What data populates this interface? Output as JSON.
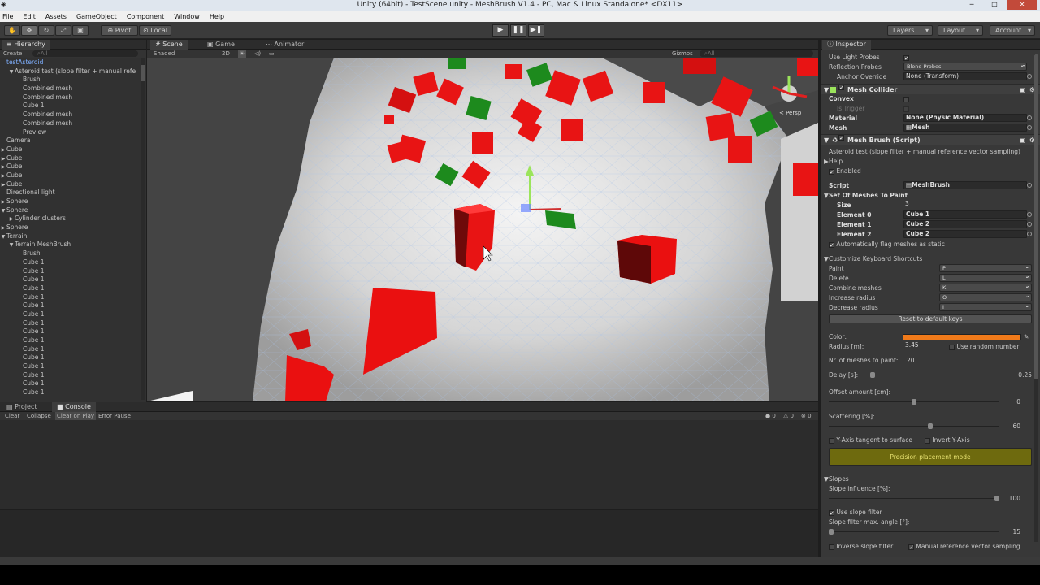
{
  "window": {
    "title": "Unity (64bit) - TestScene.unity - MeshBrush V1.4 - PC, Mac & Linux Standalone* <DX11>",
    "controls": [
      "─",
      "□",
      "✕"
    ]
  },
  "menu": [
    "File",
    "Edit",
    "Assets",
    "GameObject",
    "Component",
    "Window",
    "Help"
  ],
  "toolbar": {
    "pivot": "Pivot",
    "local": "Local",
    "play_glyphs": [
      "▶",
      "❚❚",
      "▶❚"
    ],
    "layers": "Layers",
    "layout": "Layout",
    "account": "Account"
  },
  "hierarchy": {
    "tab": "Hierarchy",
    "create": "Create",
    "search_placeholder": "All",
    "items": [
      {
        "label": "testAsteroid",
        "indent": 0,
        "arrow": "",
        "selected": true
      },
      {
        "label": "Asteroid test (slope filter + manual refe",
        "indent": 1,
        "arrow": "▼",
        "selected": false
      },
      {
        "label": "Brush",
        "indent": 2,
        "arrow": "",
        "selected": false
      },
      {
        "label": "Combined mesh",
        "indent": 2,
        "arrow": "",
        "selected": false
      },
      {
        "label": "Combined mesh",
        "indent": 2,
        "arrow": "",
        "selected": false
      },
      {
        "label": "Cube 1",
        "indent": 2,
        "arrow": "",
        "selected": false
      },
      {
        "label": "Combined mesh",
        "indent": 2,
        "arrow": "",
        "selected": false
      },
      {
        "label": "Combined mesh",
        "indent": 2,
        "arrow": "",
        "selected": false
      },
      {
        "label": "Preview",
        "indent": 2,
        "arrow": "",
        "selected": false
      },
      {
        "label": "Camera",
        "indent": 0,
        "arrow": "",
        "selected": false
      },
      {
        "label": "Cube",
        "indent": 0,
        "arrow": "▶",
        "selected": false
      },
      {
        "label": "Cube",
        "indent": 0,
        "arrow": "▶",
        "selected": false
      },
      {
        "label": "Cube",
        "indent": 0,
        "arrow": "▶",
        "selected": false
      },
      {
        "label": "Cube",
        "indent": 0,
        "arrow": "▶",
        "selected": false
      },
      {
        "label": "Cube",
        "indent": 0,
        "arrow": "▶",
        "selected": false
      },
      {
        "label": "Directional light",
        "indent": 0,
        "arrow": "",
        "selected": false
      },
      {
        "label": "Sphere",
        "indent": 0,
        "arrow": "▶",
        "selected": false
      },
      {
        "label": "Sphere",
        "indent": 0,
        "arrow": "▼",
        "selected": false
      },
      {
        "label": "Cylinder clusters",
        "indent": 1,
        "arrow": "▶",
        "selected": false
      },
      {
        "label": "Sphere",
        "indent": 0,
        "arrow": "▶",
        "selected": false
      },
      {
        "label": "Terrain",
        "indent": 0,
        "arrow": "▼",
        "selected": false
      },
      {
        "label": "Terrain MeshBrush",
        "indent": 1,
        "arrow": "▼",
        "selected": false
      },
      {
        "label": "Brush",
        "indent": 2,
        "arrow": "",
        "selected": false
      },
      {
        "label": "Cube 1",
        "indent": 2,
        "arrow": "",
        "selected": false
      },
      {
        "label": "Cube 1",
        "indent": 2,
        "arrow": "",
        "selected": false
      },
      {
        "label": "Cube 1",
        "indent": 2,
        "arrow": "",
        "selected": false
      },
      {
        "label": "Cube 1",
        "indent": 2,
        "arrow": "",
        "selected": false
      },
      {
        "label": "Cube 1",
        "indent": 2,
        "arrow": "",
        "selected": false
      },
      {
        "label": "Cube 1",
        "indent": 2,
        "arrow": "",
        "selected": false
      },
      {
        "label": "Cube 1",
        "indent": 2,
        "arrow": "",
        "selected": false
      },
      {
        "label": "Cube 1",
        "indent": 2,
        "arrow": "",
        "selected": false
      },
      {
        "label": "Cube 1",
        "indent": 2,
        "arrow": "",
        "selected": false
      },
      {
        "label": "Cube 1",
        "indent": 2,
        "arrow": "",
        "selected": false
      },
      {
        "label": "Cube 1",
        "indent": 2,
        "arrow": "",
        "selected": false
      },
      {
        "label": "Cube 1",
        "indent": 2,
        "arrow": "",
        "selected": false
      },
      {
        "label": "Cube 1",
        "indent": 2,
        "arrow": "",
        "selected": false
      },
      {
        "label": "Cube 1",
        "indent": 2,
        "arrow": "",
        "selected": false
      },
      {
        "label": "Cube 1",
        "indent": 2,
        "arrow": "",
        "selected": false
      },
      {
        "label": "Cube 1",
        "indent": 2,
        "arrow": "",
        "selected": false
      }
    ]
  },
  "scene": {
    "tabs": [
      "Scene",
      "Game",
      "Animator"
    ],
    "shaded": "Shaded",
    "mode_2d": "2D",
    "gizmos": "Gizmos",
    "search_placeholder": "All",
    "persp": "< Persp"
  },
  "console": {
    "tabs": [
      "Project",
      "Console"
    ],
    "buttons": [
      "Clear",
      "Collapse",
      "Clear on Play",
      "Error Pause"
    ],
    "counts": [
      "0",
      "0",
      "0"
    ]
  },
  "inspector": {
    "tab": "Inspector",
    "use_light_probes": "Use Light Probes",
    "reflection_probes": "Reflection Probes",
    "reflection_probes_value": "Blend Probes",
    "anchor_override": "Anchor Override",
    "anchor_override_value": "None (Transform)",
    "mesh_collider": "Mesh Collider",
    "convex": "Convex",
    "is_trigger": "Is Trigger",
    "material": "Material",
    "material_value": "None (Physic Material)",
    "mesh": "Mesh",
    "mesh_value": "Mesh",
    "mesh_brush": "Mesh Brush (Script)",
    "description": "Asteroid test (slope filter + manual reference vector sampling)",
    "help": "Help",
    "enabled": "Enabled",
    "script": "Script",
    "script_value": "MeshBrush",
    "set_of_meshes": "Set Of Meshes To Paint",
    "size": "Size",
    "size_value": "3",
    "elements": [
      {
        "label": "Element 0",
        "value": "Cube 1"
      },
      {
        "label": "Element 1",
        "value": "Cube 2"
      },
      {
        "label": "Element 2",
        "value": "Cube 2"
      }
    ],
    "auto_static": "Automatically flag meshes as static",
    "shortcuts_header": "Customize Keyboard Shortcuts",
    "shortcuts": [
      {
        "label": "Paint",
        "value": "P"
      },
      {
        "label": "Delete",
        "value": "L"
      },
      {
        "label": "Combine meshes",
        "value": "K"
      },
      {
        "label": "Increase radius",
        "value": "O"
      },
      {
        "label": "Decrease radius",
        "value": "I"
      }
    ],
    "reset_keys": "Reset to default keys",
    "color_label": "Color:",
    "color_value": "#f07a1a",
    "radius_label": "Radius [m]:",
    "radius_value": "3.45",
    "use_random_number": "Use random number",
    "nr_meshes_label": "Nr. of meshes to paint:",
    "nr_meshes_value": "20",
    "delay_label": "Delay [s]:",
    "delay_value": "0.25",
    "delay_fraction": 0.25,
    "offset_label": "Offset amount [cm]:",
    "offset_value": "0",
    "offset_fraction": 0.5,
    "scattering_label": "Scattering [%]:",
    "scattering_value": "60",
    "scattering_fraction": 0.6,
    "y_tangent": "Y-Axis tangent to surface",
    "invert_y": "Invert Y-Axis",
    "precision_button": "Precision placement mode",
    "slopes_header": "Slopes",
    "slope_influence_label": "Slope influence [%]:",
    "slope_influence_value": "100",
    "slope_influence_fraction": 1.0,
    "use_slope_filter": "Use slope filter",
    "slope_max_label": "Slope filter max. angle [°]:",
    "slope_max_value": "15",
    "slope_max_fraction": 0.0,
    "inverse_slope": "Inverse slope filter",
    "manual_ref": "Manual reference vector sampling"
  }
}
